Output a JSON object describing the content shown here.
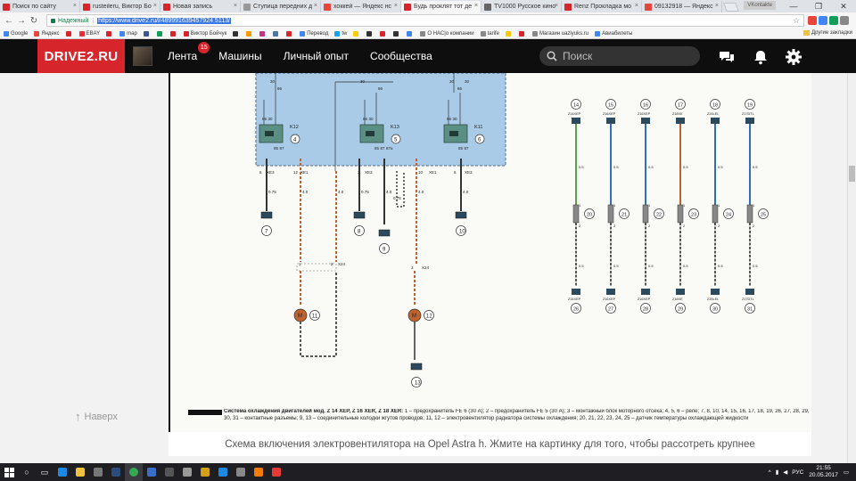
{
  "browser": {
    "tabs": [
      {
        "title": "Поиск по сайту",
        "color": "#d6262b",
        "active": false
      },
      {
        "title": "rusteileru, Виктор Бо",
        "color": "#d6262b",
        "active": false
      },
      {
        "title": "Новая запись",
        "color": "#d6262b",
        "active": false
      },
      {
        "title": "Ступица передних д",
        "color": "#999999",
        "active": false
      },
      {
        "title": "хоккей — Яндекс нс",
        "color": "#e8453c",
        "active": false
      },
      {
        "title": "Будь проклят тот де",
        "color": "#d6262b",
        "active": true
      },
      {
        "title": "TV1000 Русское кино",
        "color": "#666666",
        "active": false
      },
      {
        "title": "Renz Прокладка мо",
        "color": "#d6262b",
        "active": false
      },
      {
        "title": "09132918 — Яндекс",
        "color": "#e8453c",
        "active": false
      }
    ],
    "profile_label": "VKontakte",
    "window_controls": [
      "—",
      "❐",
      "✕"
    ],
    "address": {
      "secure_label": "Надежный",
      "url": "https://www.drive2.ru/l/489991639457924 5113/"
    },
    "bookmarks": [
      {
        "label": "Google",
        "color": "#4285f4"
      },
      {
        "label": "Яндекс",
        "color": "#e8453c"
      },
      {
        "label": "",
        "color": "#d6262b"
      },
      {
        "label": "EBAY",
        "color": "#e53238"
      },
      {
        "label": "",
        "color": "#d6262b"
      },
      {
        "label": "map",
        "color": "#4285f4"
      },
      {
        "label": "",
        "color": "#3b5998"
      },
      {
        "label": "",
        "color": "#0f9d58"
      },
      {
        "label": "",
        "color": "#d6262b"
      },
      {
        "label": "Виктор Бойчук",
        "color": "#d6262b"
      },
      {
        "label": "",
        "color": "#333333"
      },
      {
        "label": "",
        "color": "#ff9900"
      },
      {
        "label": "",
        "color": "#c13584"
      },
      {
        "label": "",
        "color": "#4c75a3"
      },
      {
        "label": "",
        "color": "#d6262b"
      },
      {
        "label": "Перевод",
        "color": "#4285f4"
      },
      {
        "label": "tw",
        "color": "#1da1f2"
      },
      {
        "label": "",
        "color": "#ffcc00"
      },
      {
        "label": "",
        "color": "#333333"
      },
      {
        "label": "",
        "color": "#d6262b"
      },
      {
        "label": "",
        "color": "#333333"
      },
      {
        "label": "",
        "color": "#4285f4"
      },
      {
        "label": "О НАС|о компании",
        "color": "#888888"
      },
      {
        "label": "tarife",
        "color": "#888888"
      },
      {
        "label": "",
        "color": "#ffcc00"
      },
      {
        "label": "",
        "color": "#d6262b"
      },
      {
        "label": "Магазин uazlyuks.ru",
        "color": "#888888"
      },
      {
        "label": "Авиабилеты",
        "color": "#4285f4"
      }
    ],
    "other_bookmarks": "Другие закладки"
  },
  "site": {
    "logo": "DRIVE2.RU",
    "menu": [
      {
        "label": "Лента",
        "badge": "15"
      },
      {
        "label": "Машины",
        "badge": ""
      },
      {
        "label": "Личный опыт",
        "badge": ""
      },
      {
        "label": "Сообщества",
        "badge": ""
      }
    ],
    "search_placeholder": "Поиск",
    "back_up": "Наверх"
  },
  "diagram": {
    "relays": [
      {
        "id": "K12",
        "num": "4"
      },
      {
        "id": "K13",
        "num": "5"
      },
      {
        "id": "K11",
        "num": "6"
      }
    ],
    "top_pins": [
      "30",
      "86",
      "30",
      "86",
      "30",
      "86",
      "30"
    ],
    "relay_pin_labels": [
      "86",
      "30",
      "85",
      "87",
      "86",
      "30",
      "85",
      "87",
      "87a",
      "86",
      "30",
      "85",
      "87"
    ],
    "connector_labels": [
      "6",
      "XE3",
      "12",
      "XE1",
      "3",
      "XE3",
      "10",
      "XE1",
      "6",
      "XE3"
    ],
    "wire_gauges": [
      "0.75",
      "4.0",
      "4.0",
      "0.75",
      "4.0",
      "0.75",
      "4.0",
      "4.0"
    ],
    "ground_circles": [
      "7",
      "8",
      "9",
      "10",
      "13"
    ],
    "motors": [
      {
        "label": "M",
        "num": "11"
      },
      {
        "label": "M",
        "num": "12"
      }
    ],
    "x24_labels": [
      "1",
      "2",
      "X24",
      "3",
      "X24"
    ],
    "sensor_columns": [
      {
        "top": "14",
        "code": "Z14XEP",
        "bottom": "26",
        "mid": "20",
        "color": "#5a9f4b"
      },
      {
        "top": "15",
        "code": "Z16XEP",
        "bottom": "27",
        "mid": "21",
        "color": "#2e6fc0"
      },
      {
        "top": "16",
        "code": "Z16XEP",
        "bottom": "28",
        "mid": "22",
        "color": "#2e6fc0"
      },
      {
        "top": "17",
        "code": "Z18XE",
        "bottom": "29",
        "mid": "23",
        "color": "#c0622e"
      },
      {
        "top": "18",
        "code": "Z20LEL",
        "bottom": "30",
        "mid": "24",
        "color": "#2e6fc0"
      },
      {
        "top": "19",
        "code": "Z17DTL",
        "bottom": "31",
        "mid": "25",
        "color": "#2e6fc0"
      }
    ],
    "sensor_wire_labels": [
      "0.5",
      "1",
      "2",
      "0.5"
    ],
    "bottom_caption_title": "Система охлаждения двигателей мод. Z 14 XEP, Z 16 XER, Z 18 XER:",
    "bottom_caption_text": "1 – предохранитель FE 6 (30 А); 2 – предохранитель FE 5 (30 А); 3 – монтажный блок моторного отсека; 4, 5, 6 – реле; 7, 8, 10, 14, 15, 16, 17, 18, 19, 26, 27, 28, 29, 30, 31 – контактные разъемы; 9, 13 – соединительные колодки жгутов проводов; 11, 12 – электровентилятор радиатора системы охлаждения; 20, 21, 22, 23, 24, 25 – датчик температуры охлаждающей жидкости"
  },
  "caption": "Схема включения электровентилятора на Opel Astra h. Жмите на картинку для того, чтобы рассотреть крупнее",
  "taskbar": {
    "lang": "РУС",
    "time": "21:55",
    "date": "20.05.2017"
  }
}
